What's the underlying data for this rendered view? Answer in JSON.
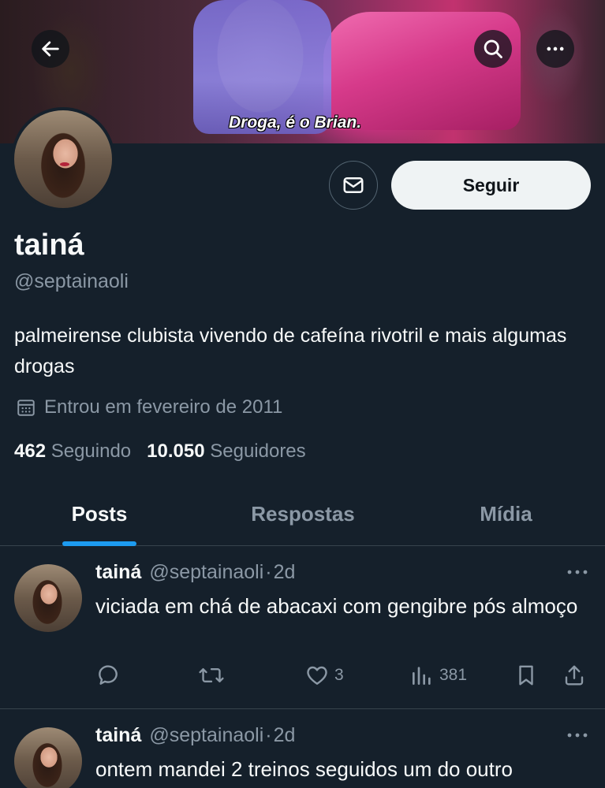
{
  "banner": {
    "caption": "Droga, é o Brian."
  },
  "profile": {
    "name": "tainá",
    "handle": "@septainaoli",
    "bio": "palmeirense clubista vivendo de cafeína rivotril e mais algumas drogas",
    "joined": "Entrou em fevereiro de 2011",
    "following_count": "462",
    "following_label": "Seguindo",
    "followers_count": "10.050",
    "followers_label": "Seguidores",
    "follow_label": "Seguir"
  },
  "tabs": [
    {
      "label": "Posts",
      "active": true
    },
    {
      "label": "Respostas",
      "active": false
    },
    {
      "label": "Mídia",
      "active": false
    }
  ],
  "tweets": [
    {
      "name": "tainá",
      "handle": "@septainaoli",
      "sep": "·",
      "time": "2d",
      "text": "viciada em chá de abacaxi com gengibre pós almoço",
      "likes": "3",
      "views": "381"
    },
    {
      "name": "tainá",
      "handle": "@septainaoli",
      "sep": "·",
      "time": "2d",
      "text": "ontem mandei 2 treinos seguidos um do outro"
    }
  ],
  "icons": [
    "back-arrow-icon",
    "search-icon",
    "more-icon",
    "mail-icon",
    "calendar-icon",
    "reply-icon",
    "retweet-icon",
    "like-icon",
    "views-icon",
    "bookmark-icon",
    "share-icon"
  ],
  "colors": {
    "background": "#15202b",
    "accent": "#1d9bf0",
    "muted": "#8b98a5",
    "text": "#f7f9f9"
  }
}
